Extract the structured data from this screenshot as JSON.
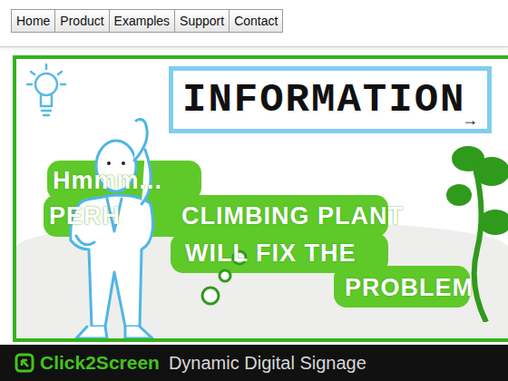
{
  "nav": {
    "items": [
      {
        "label": "Home",
        "selected": false
      },
      {
        "label": "Product",
        "selected": false
      },
      {
        "label": "Examples",
        "selected": false
      },
      {
        "label": "Support",
        "selected": false
      },
      {
        "label": "Contact",
        "selected": false
      }
    ]
  },
  "banner": {
    "sign": "INFORMATION",
    "sign_arrow": "→",
    "lines": [
      "Hmmm...",
      "PERH",
      "CLIMBING PLANT",
      "WILL FIX THE",
      "PROBLEM"
    ]
  },
  "footer": {
    "brand": "Click2Screen",
    "tagline": "Dynamic Digital Signage"
  }
}
